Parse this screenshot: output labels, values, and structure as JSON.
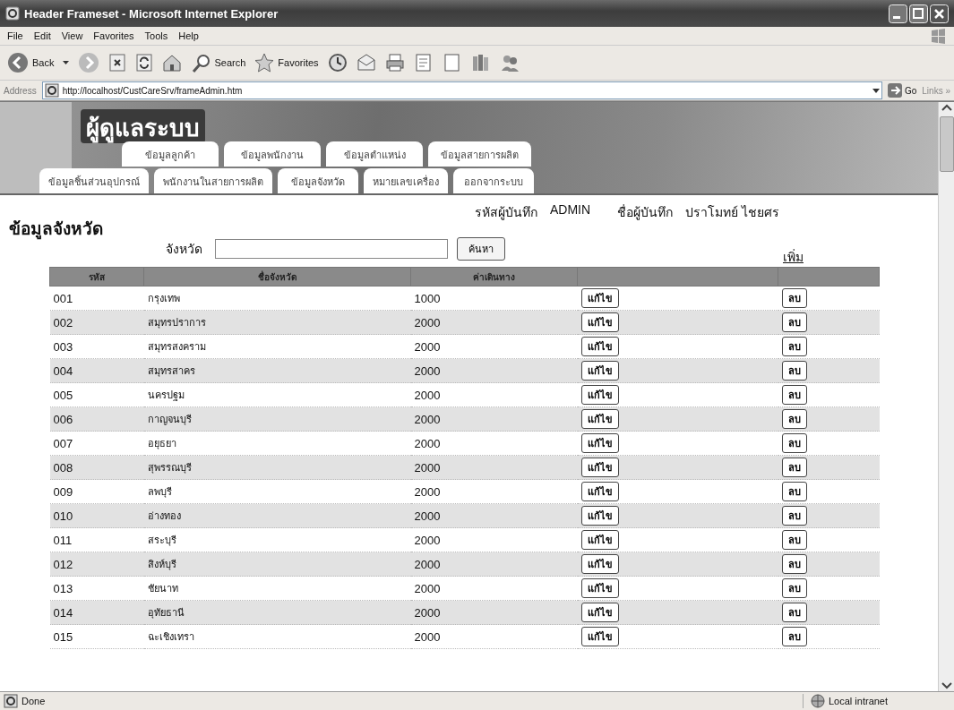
{
  "window": {
    "title": "Header Frameset - Microsoft Internet Explorer"
  },
  "menu_bar": [
    "File",
    "Edit",
    "View",
    "Favorites",
    "Tools",
    "Help"
  ],
  "toolbar": {
    "back": "Back",
    "search": "Search",
    "favorites": "Favorites"
  },
  "address_bar": {
    "label": "Address",
    "url": "http://localhost/CustCareSrv/frameAdmin.htm",
    "go": "Go",
    "links": "Links »"
  },
  "banner": {
    "title": "ผู้ดูแลระบบ",
    "tabs_top": [
      "ข้อมูลลูกค้า",
      "ข้อมูลพนักงาน",
      "ข้อมูลตำแหน่ง",
      "ข้อมูลสายการผลิต"
    ],
    "tabs_bottom": [
      "ข้อมูลชิ้นส่วนอุปกรณ์",
      "พนักงานในสายการผลิต",
      "ข้อมูลจังหวัด",
      "หมายเลขเครื่อง",
      "ออกจากระบบ"
    ]
  },
  "page": {
    "heading": "ข้อมูลจังหวัด",
    "user_code_label": "รหัสผู้บันทึก",
    "user_code": "ADMIN",
    "user_name_label": "ชื่อผู้บันทึก",
    "user_name": "ปราโมทย์ ไชยศร",
    "search": {
      "label": "จังหวัด",
      "button": "ค้นหา"
    },
    "add_link": "เพิ่ม"
  },
  "table": {
    "columns": [
      "รหัส",
      "ชื่อจังหวัด",
      "ค่าเดินทาง"
    ],
    "rows": [
      {
        "code": "001",
        "name": "กรุงเทพ",
        "cost": "1000",
        "edit": "แก้ไข",
        "delete": "ลบ"
      },
      {
        "code": "002",
        "name": "สมุทรปราการ",
        "cost": "2000",
        "edit": "แก้ไข",
        "delete": "ลบ"
      },
      {
        "code": "003",
        "name": "สมุทรสงคราม",
        "cost": "2000",
        "edit": "แก้ไข",
        "delete": "ลบ"
      },
      {
        "code": "004",
        "name": "สมุทรสาคร",
        "cost": "2000",
        "edit": "แก้ไข",
        "delete": "ลบ"
      },
      {
        "code": "005",
        "name": "นครปฐม",
        "cost": "2000",
        "edit": "แก้ไข",
        "delete": "ลบ"
      },
      {
        "code": "006",
        "name": "กาญจนบุรี",
        "cost": "2000",
        "edit": "แก้ไข",
        "delete": "ลบ"
      },
      {
        "code": "007",
        "name": "อยุธยา",
        "cost": "2000",
        "edit": "แก้ไข",
        "delete": "ลบ"
      },
      {
        "code": "008",
        "name": "สุพรรณบุรี",
        "cost": "2000",
        "edit": "แก้ไข",
        "delete": "ลบ"
      },
      {
        "code": "009",
        "name": "ลพบุรี",
        "cost": "2000",
        "edit": "แก้ไข",
        "delete": "ลบ"
      },
      {
        "code": "010",
        "name": "อ่างทอง",
        "cost": "2000",
        "edit": "แก้ไข",
        "delete": "ลบ"
      },
      {
        "code": "011",
        "name": "สระบุรี",
        "cost": "2000",
        "edit": "แก้ไข",
        "delete": "ลบ"
      },
      {
        "code": "012",
        "name": "สิงห์บุรี",
        "cost": "2000",
        "edit": "แก้ไข",
        "delete": "ลบ"
      },
      {
        "code": "013",
        "name": "ชัยนาท",
        "cost": "2000",
        "edit": "แก้ไข",
        "delete": "ลบ"
      },
      {
        "code": "014",
        "name": "อุทัยธานี",
        "cost": "2000",
        "edit": "แก้ไข",
        "delete": "ลบ"
      },
      {
        "code": "015",
        "name": "ฉะเชิงเทรา",
        "cost": "2000",
        "edit": "แก้ไข",
        "delete": "ลบ"
      }
    ]
  },
  "status_bar": {
    "text": "Done",
    "zone": "Local intranet"
  }
}
